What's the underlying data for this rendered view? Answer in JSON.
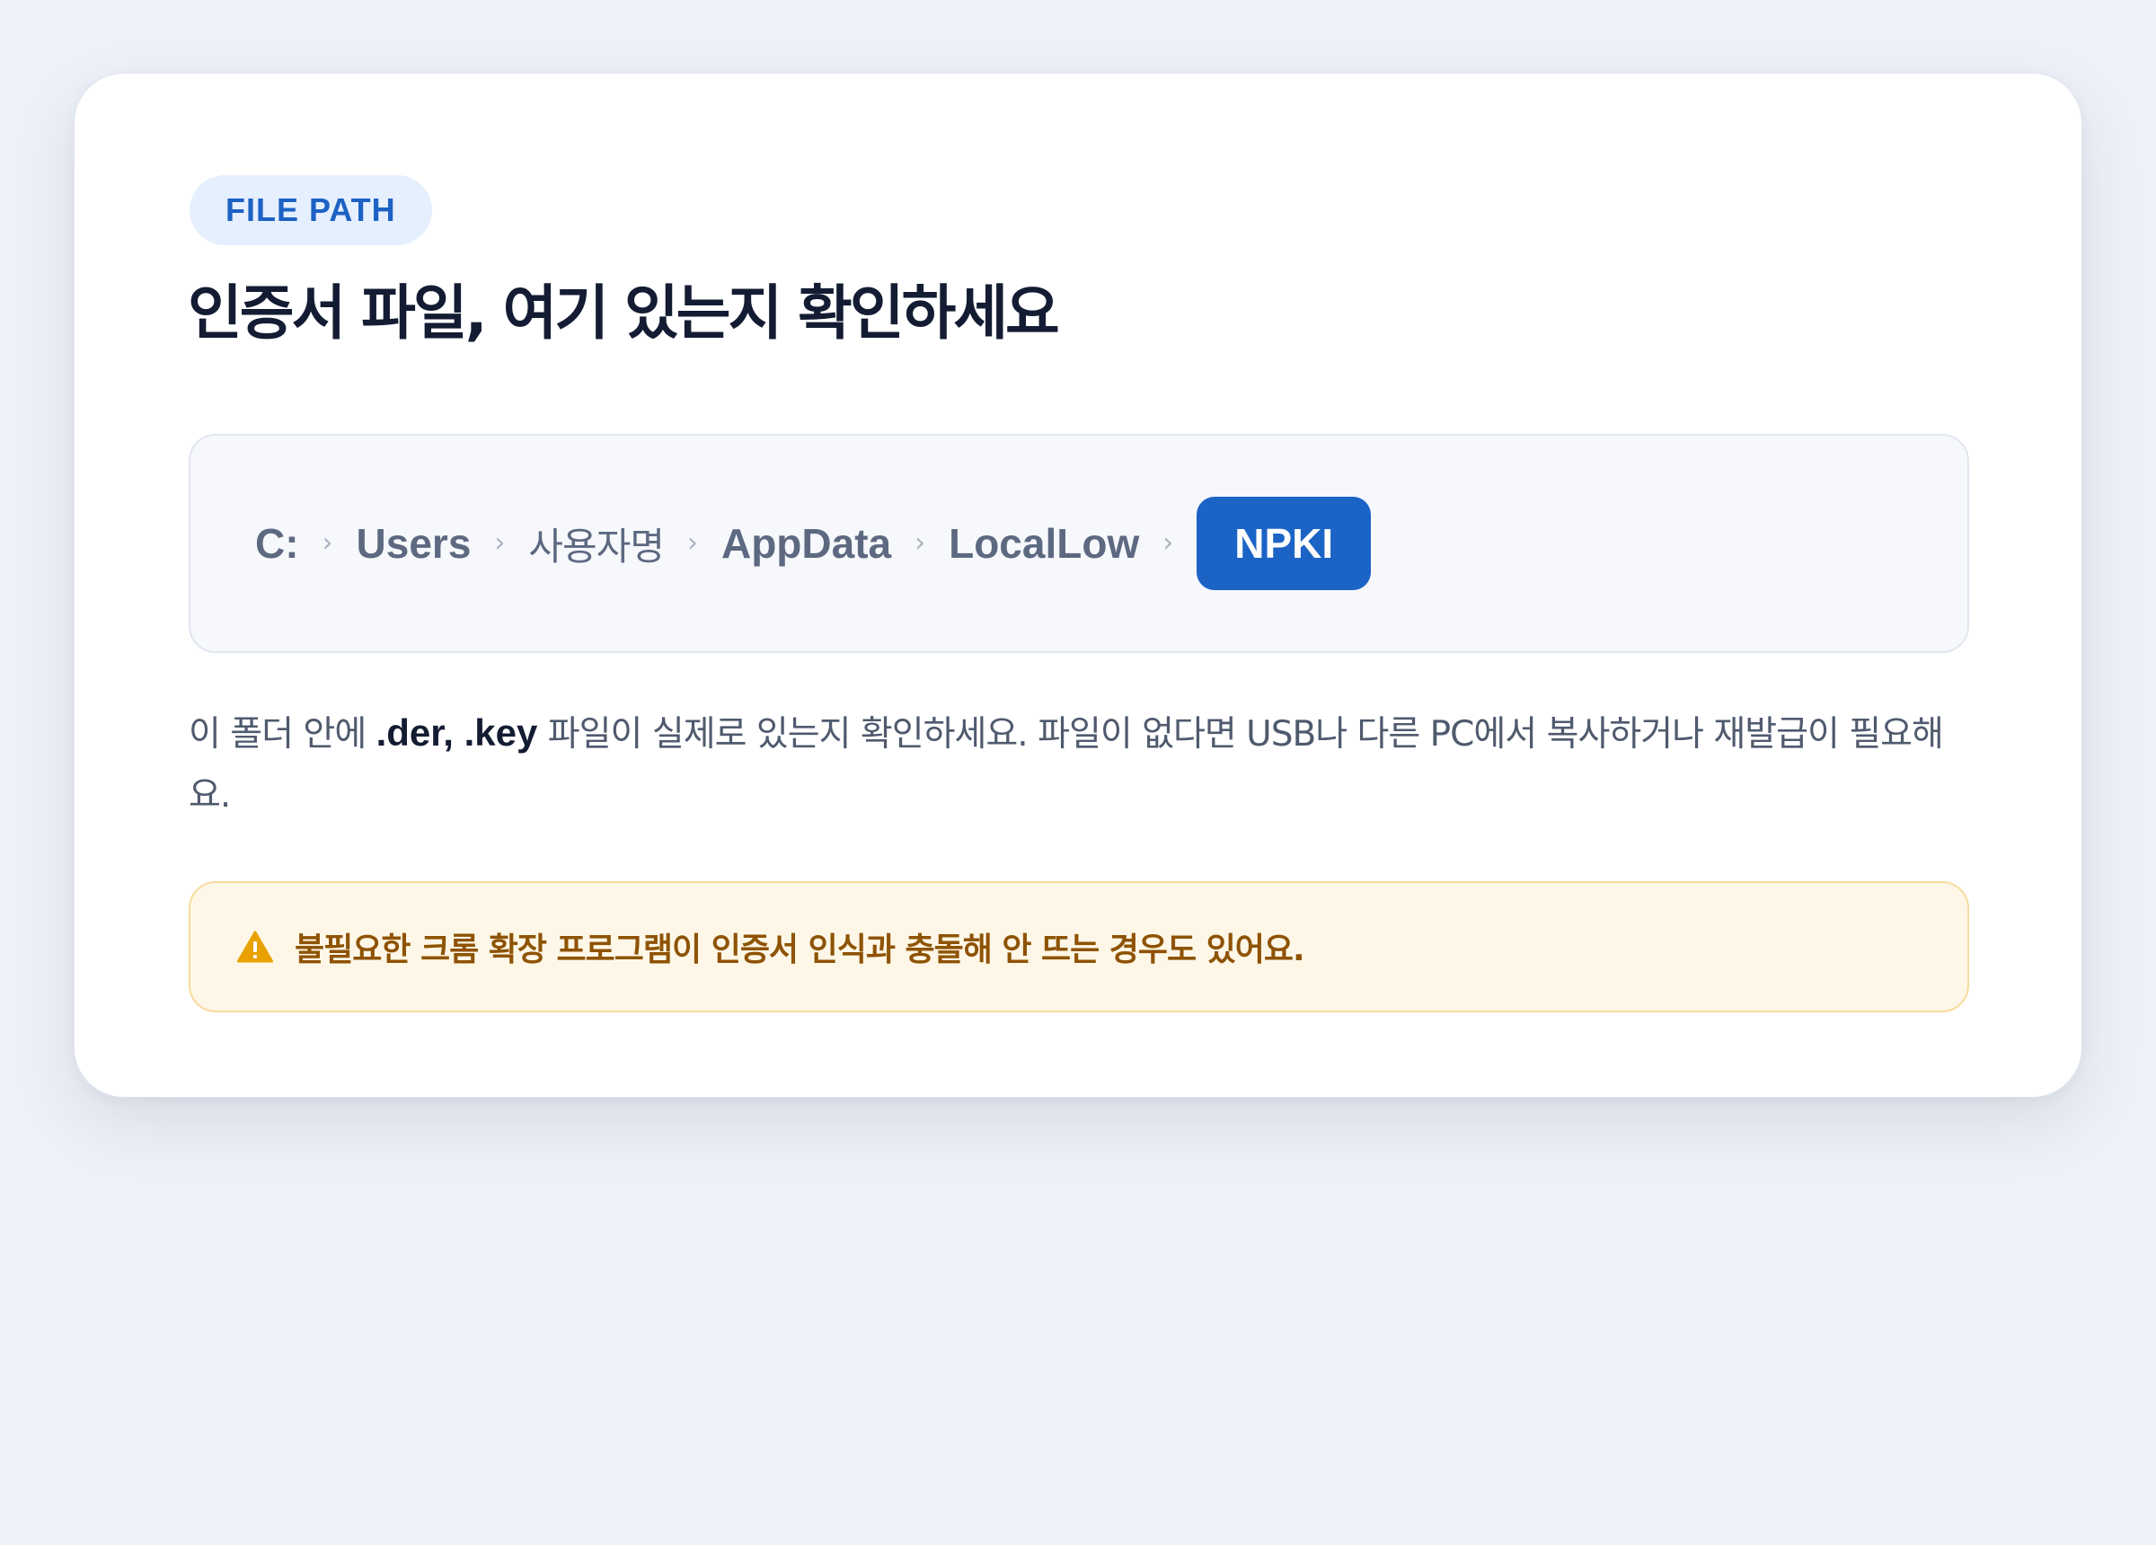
{
  "card": {
    "badge": "FILE PATH",
    "title": "인증서 파일, 여기 있는지 확인하세요"
  },
  "path": {
    "segments": [
      "C:",
      "Users",
      "사용자명",
      "AppData",
      "LocalLow"
    ],
    "separator": "›",
    "active": "NPKI"
  },
  "description": {
    "before": "이 폴더 안에 ",
    "highlight": ".der, .key",
    "after": " 파일이 실제로 있는지 확인하세요. 파일이 없다면 USB나 다른 PC에서 복사하거나 재발급이 필요해요."
  },
  "warning": {
    "icon": "warning-triangle-icon",
    "text": "불필요한 크롬 확장 프로그램이 인증서 인식과 충돌해 안 뜨는 경우도 있어요."
  },
  "colors": {
    "background": "#eef1f8",
    "accent": "#1c63c6",
    "title": "#131c33",
    "warning_bg": "#fef7e7",
    "warning_text": "#8e5304",
    "warning_icon": "#e9a100"
  }
}
